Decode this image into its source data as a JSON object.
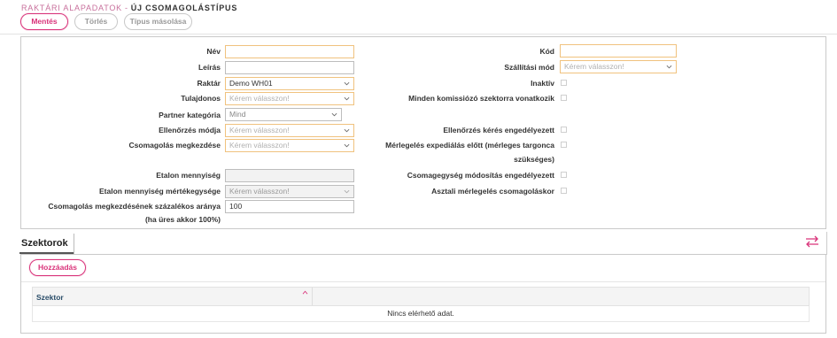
{
  "breadcrumb": {
    "parent": "RAKTÁRI ALAPADATOK",
    "separator": "-",
    "current": "ÚJ CSOMAGOLÁSTÍPUS"
  },
  "toolbar": {
    "save_label": "Mentés",
    "delete_label": "Törlés",
    "copy_label": "Típus másolása"
  },
  "form": {
    "left": {
      "name_label": "Név",
      "name_value": "",
      "description_label": "Leírás",
      "description_value": "",
      "warehouse_label": "Raktár",
      "warehouse_value": "Demo WH01",
      "owner_label": "Tulajdonos",
      "owner_placeholder": "Kérem válasszon!",
      "partner_category_label": "Partner kategória",
      "partner_category_value": "Mind",
      "check_mode_label": "Ellenőrzés módja",
      "check_mode_placeholder": "Kérem válasszon!",
      "packing_start_label": "Csomagolás megkezdése",
      "packing_start_placeholder": "Kérem válasszon!",
      "etalon_qty_label": "Etalon mennyiség",
      "etalon_qty_value": "",
      "etalon_unit_label": "Etalon mennyiség mértékegysége",
      "etalon_unit_placeholder": "Kérem válasszon!",
      "percent_label": "Csomagolás megkezdésének százalékos aránya",
      "percent_label_note": "(ha üres akkor 100%)",
      "percent_value": "100"
    },
    "right": {
      "code_label": "Kód",
      "code_value": "",
      "shipping_mode_label": "Szállítási mód",
      "shipping_mode_placeholder": "Kérem válasszon!",
      "inactive_label": "Inaktív",
      "all_sectors_label": "Minden komissiózó szektorra vonatkozik",
      "check_request_label": "Ellenőrzés kérés engedélyezett",
      "weighing_label_line1": "Mérlegelés expediálás előtt (mérleges targonca",
      "weighing_label_line2": "szükséges)",
      "unit_modify_label": "Csomagegység módosítás engedélyezett",
      "desk_weighing_label": "Asztali mérlegelés csomagoláskor"
    }
  },
  "sectors": {
    "tab_label": "Szektorok",
    "add_label": "Hozzáadás",
    "column_sector": "Szektor",
    "empty_text": "Nincs elérhető adat."
  },
  "colors": {
    "accent": "#d9337a",
    "required_border": "#f0c27e",
    "breadcrumb": "#c8709c"
  },
  "icons": {
    "swap": "swap-arrows-icon",
    "sort": "sort-asc-icon",
    "dropdown": "chevron-down-icon"
  }
}
